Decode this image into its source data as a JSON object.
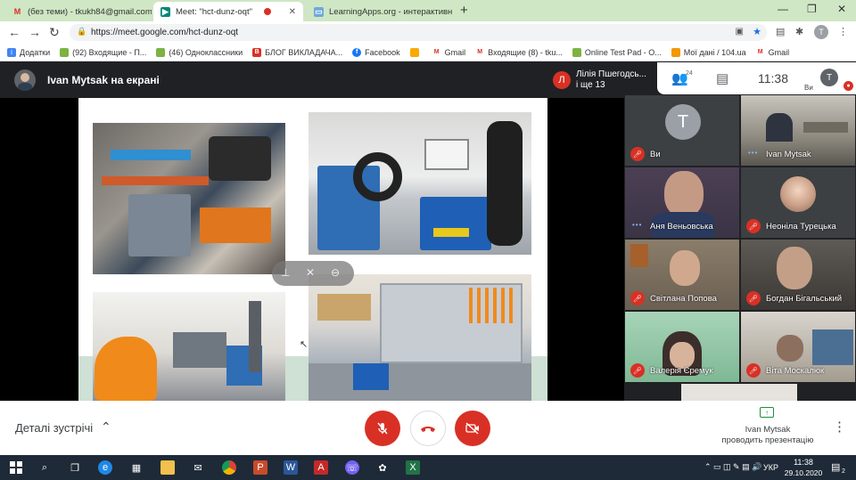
{
  "browser": {
    "tabs": [
      {
        "label": "(без теми) - tkukh84@gmail.com",
        "icon": "gmail-icon"
      },
      {
        "label": "Meet: \"hct-dunz-oqt\"",
        "icon": "meet-icon",
        "active": true
      },
      {
        "label": "LearningApps.org - интерактивн",
        "icon": "learningapps-icon"
      }
    ],
    "new_tab": "+",
    "url": "https://meet.google.com/hct-dunz-oqt",
    "bookmarks": [
      {
        "label": "Додатки",
        "color": "#4285f4"
      },
      {
        "label": "(92) Входящие - П...",
        "color": "#7cb342"
      },
      {
        "label": "(46) Одноклассники",
        "color": "#7cb342"
      },
      {
        "label": "БЛОГ ВИКЛАДАЧА...",
        "color": "#d93025"
      },
      {
        "label": "Facebook",
        "color": "#1877f2"
      },
      {
        "label": "",
        "color": "#f9ab00"
      },
      {
        "label": "Gmail",
        "color": "#d93025"
      },
      {
        "label": "Входящие (8) - tku...",
        "color": "#d93025"
      },
      {
        "label": "Online Test Pad - О...",
        "color": "#7cb342"
      },
      {
        "label": "Мої дані / 104.ua",
        "color": "#f29900"
      },
      {
        "label": "Gmail",
        "color": "#d93025"
      }
    ],
    "profile_letter": "T"
  },
  "meet": {
    "title": "Ivan Mytsak на екрані",
    "people_chip": {
      "avatar_letter": "Л",
      "line1": "Лілія Пшегодсь...",
      "line2": "і ще 13"
    },
    "participant_count": "24",
    "clock": "11:38",
    "me_letter": "T",
    "me_label": "Ви",
    "participants": [
      {
        "name": "Ви",
        "letter": "T",
        "muted": true
      },
      {
        "name": "Ivan Mytsak",
        "muted": false
      },
      {
        "name": "Аня Веньовська",
        "muted": false
      },
      {
        "name": "Неоніла Турецька",
        "muted": true
      },
      {
        "name": "Світлана Попова",
        "muted": true
      },
      {
        "name": "Богдан Бігальський",
        "muted": true
      },
      {
        "name": "Валерія Єремук",
        "muted": true
      },
      {
        "name": "Віта Москалюк",
        "muted": true
      }
    ],
    "details_label": "Деталі зустрічі",
    "presenter_name": "Ivan Mytsak",
    "presenter_status": "проводить презентацію"
  },
  "taskbar": {
    "lang": "УКР",
    "time": "11:38",
    "date": "29.10.2020",
    "notifications": "2"
  }
}
